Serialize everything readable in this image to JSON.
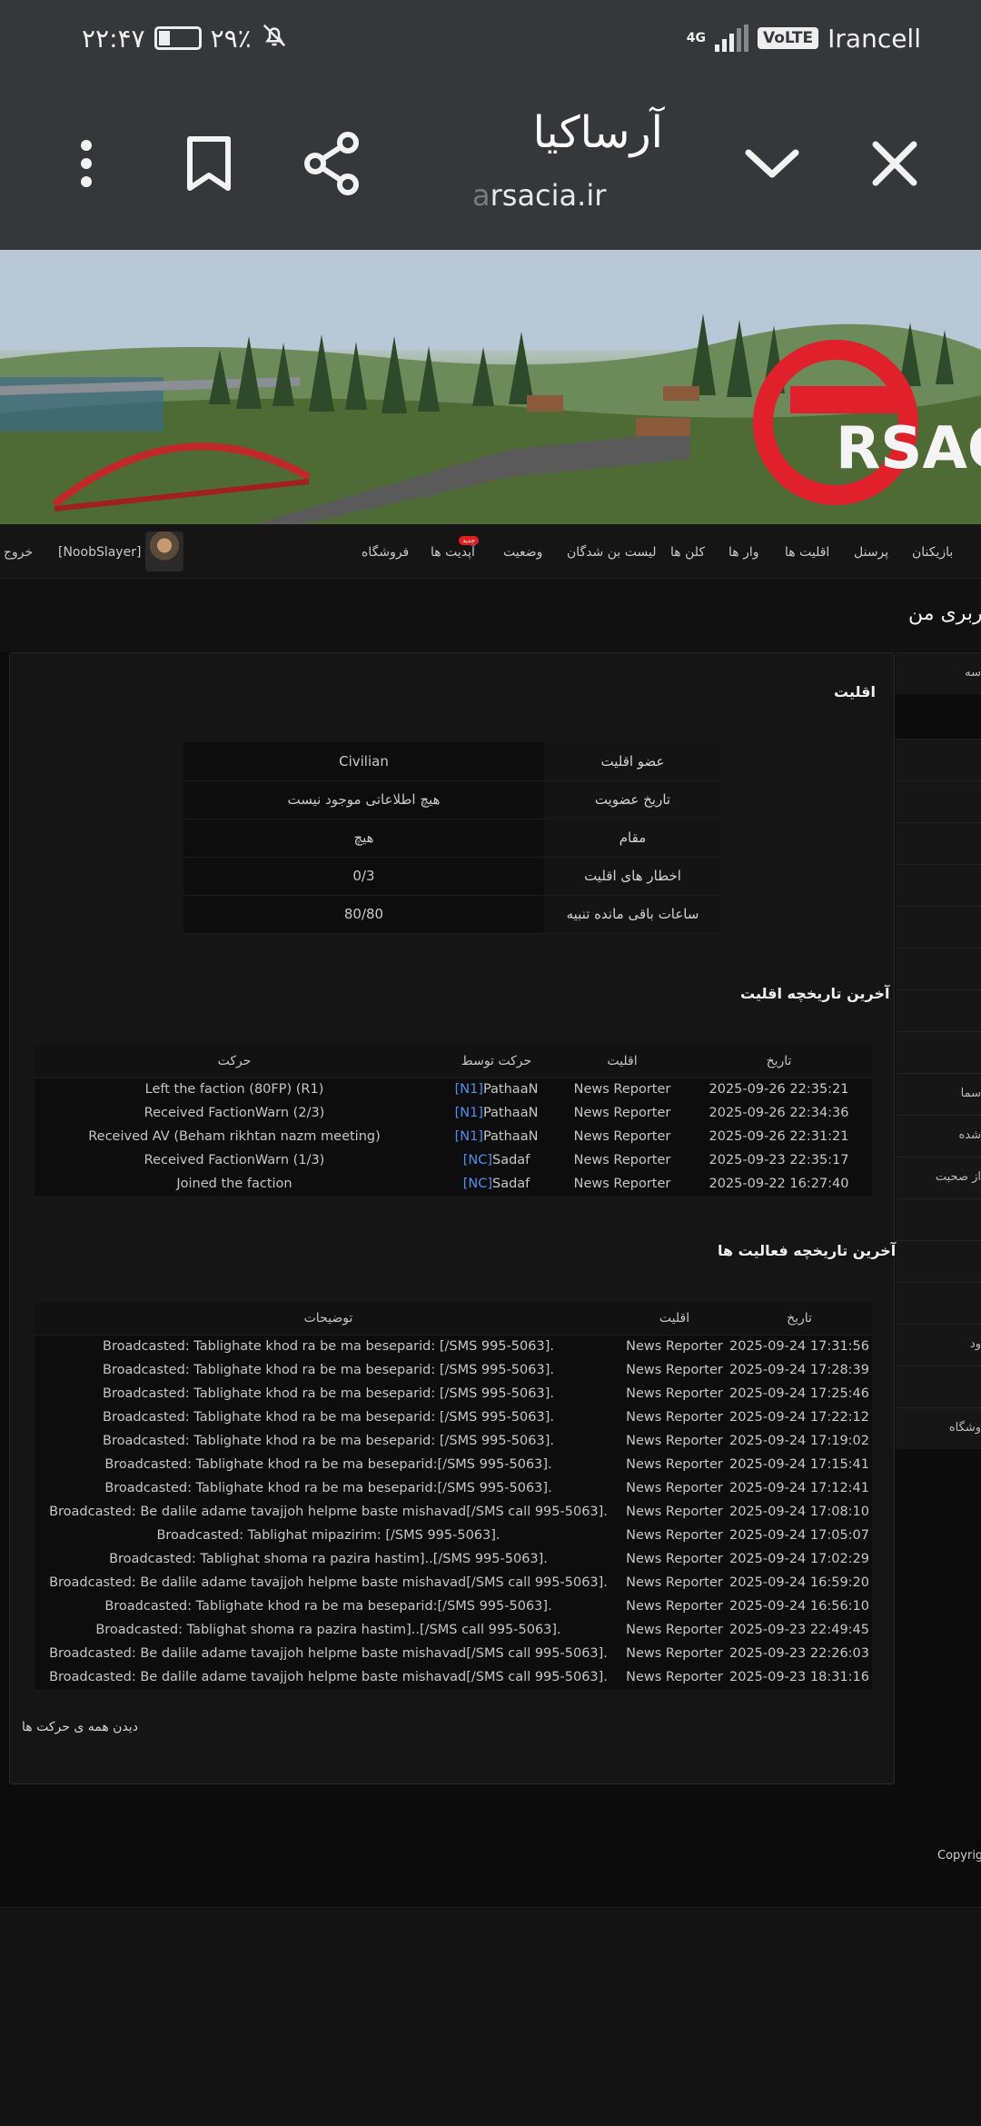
{
  "status_bar": {
    "time": "۲۲:۴۷",
    "battery": "۲۹٪",
    "battery_level": 0.29,
    "network_type": "4G",
    "volte": "VoLTE",
    "carrier": "Irancell"
  },
  "browser": {
    "title": "آرساکیا",
    "url_visible": "rsacia.ir",
    "url_faded": "a"
  },
  "banner": {
    "logo_text": "RSAC"
  },
  "nav": {
    "logout": "خروج",
    "username": "[NoobSlayer]",
    "items": [
      "فروشگاه",
      "آپدیت ها",
      "وضعیت",
      "لیست بن شدگان",
      "کلن ها",
      "وار ها",
      "اقلیت ها",
      "پرسنل",
      "بازیکنان"
    ],
    "new_badge": "جدید"
  },
  "page_header": "کاربری من",
  "side_items": [
    "سه",
    "سما",
    "شده",
    "از صحبت",
    "ود",
    "وشگاه"
  ],
  "faction_section": {
    "title": "اقلیت",
    "rows": [
      {
        "label": "عضو اقلیت",
        "value": "Civilian"
      },
      {
        "label": "تاریخ عضویت",
        "value": "هیچ اطلاعاتی موجود نیست"
      },
      {
        "label": "مقام",
        "value": "هیچ"
      },
      {
        "label": "اخطار های اقلیت",
        "value": "0/3"
      },
      {
        "label": "ساعات باقی مانده تنبیه",
        "value": "80/80"
      }
    ]
  },
  "faction_history": {
    "title": "آخرین تاریخچه اقلیت",
    "headers": {
      "date": "تاریخ",
      "faction": "اقلیت",
      "by": "حرکت توسط",
      "action": "حرکت"
    },
    "rows": [
      {
        "date": "2025-09-26 22:35:21",
        "faction": "News Reporter",
        "tag": "[N1]",
        "name": "PathaaN",
        "action": "Left the faction (80FP) (R1)"
      },
      {
        "date": "2025-09-26 22:34:36",
        "faction": "News Reporter",
        "tag": "[N1]",
        "name": "PathaaN",
        "action": "Received FactionWarn (2/3)"
      },
      {
        "date": "2025-09-26 22:31:21",
        "faction": "News Reporter",
        "tag": "[N1]",
        "name": "PathaaN",
        "action": "Received AV (Beham rikhtan nazm meeting)"
      },
      {
        "date": "2025-09-23 22:35:17",
        "faction": "News Reporter",
        "tag": "[NC]",
        "name": "Sadaf",
        "action": "Received FactionWarn (1/3)"
      },
      {
        "date": "2025-09-22 16:27:40",
        "faction": "News Reporter",
        "tag": "[NC]",
        "name": "Sadaf",
        "action": "Joined the faction"
      }
    ]
  },
  "activity_history": {
    "title": "آخرین تاریخچه فعالیت ها",
    "headers": {
      "date": "تاریخ",
      "faction": "اقلیت",
      "desc": "توضیحات"
    },
    "rows": [
      {
        "date": "2025-09-24 17:31:56",
        "faction": "News Reporter",
        "desc": "Broadcasted: Tablighate khod ra be ma beseparid: [/SMS 995-5063]."
      },
      {
        "date": "2025-09-24 17:28:39",
        "faction": "News Reporter",
        "desc": "Broadcasted: Tablighate khod ra be ma beseparid: [/SMS 995-5063]."
      },
      {
        "date": "2025-09-24 17:25:46",
        "faction": "News Reporter",
        "desc": "Broadcasted: Tablighate khod ra be ma beseparid: [/SMS 995-5063]."
      },
      {
        "date": "2025-09-24 17:22:12",
        "faction": "News Reporter",
        "desc": "Broadcasted: Tablighate khod ra be ma beseparid: [/SMS 995-5063]."
      },
      {
        "date": "2025-09-24 17:19:02",
        "faction": "News Reporter",
        "desc": "Broadcasted: Tablighate khod ra be ma beseparid: [/SMS 995-5063]."
      },
      {
        "date": "2025-09-24 17:15:41",
        "faction": "News Reporter",
        "desc": "Broadcasted: Tablighate khod ra be ma beseparid:[/SMS 995-5063]."
      },
      {
        "date": "2025-09-24 17:12:41",
        "faction": "News Reporter",
        "desc": "Broadcasted: Tablighate khod ra be ma beseparid:[/SMS 995-5063]."
      },
      {
        "date": "2025-09-24 17:08:10",
        "faction": "News Reporter",
        "desc": "Broadcasted: Be dalile adame tavajjoh helpme baste mishavad[/SMS call 995-5063]."
      },
      {
        "date": "2025-09-24 17:05:07",
        "faction": "News Reporter",
        "desc": "Broadcasted: Tablighat mipazirim: [/SMS 995-5063]."
      },
      {
        "date": "2025-09-24 17:02:29",
        "faction": "News Reporter",
        "desc": "Broadcasted: Tablighat shoma ra pazira hastim]..[/SMS 995-5063]."
      },
      {
        "date": "2025-09-24 16:59:20",
        "faction": "News Reporter",
        "desc": "Broadcasted: Be dalile adame tavajjoh helpme baste mishavad[/SMS call 995-5063]."
      },
      {
        "date": "2025-09-24 16:56:10",
        "faction": "News Reporter",
        "desc": "Broadcasted: Tablighate khod ra be ma beseparid:[/SMS 995-5063]."
      },
      {
        "date": "2025-09-23 22:49:45",
        "faction": "News Reporter",
        "desc": "Broadcasted: Tablighat shoma ra pazira hastim]..[/SMS call 995-5063]."
      },
      {
        "date": "2025-09-23 22:26:03",
        "faction": "News Reporter",
        "desc": "Broadcasted: Be dalile adame tavajjoh helpme baste mishavad[/SMS call 995-5063]."
      },
      {
        "date": "2025-09-23 18:31:16",
        "faction": "News Reporter",
        "desc": "Broadcasted: Be dalile adame tavajjoh helpme baste mishavad[/SMS call 995-5063]."
      }
    ]
  },
  "view_all": "دیدن همه ی حرکت ها",
  "footer": {
    "copyright": "Copyright"
  },
  "colors": {
    "faction_link": "#8e7bc8",
    "tag_link": "#4f8ef0",
    "chrome_bg": "#36373b",
    "logo_red": "#e0202a"
  },
  "icons": [
    "kebab-menu-icon",
    "bookmark-icon",
    "share-icon",
    "chevron-down-icon",
    "close-icon",
    "mute-bell-icon"
  ]
}
